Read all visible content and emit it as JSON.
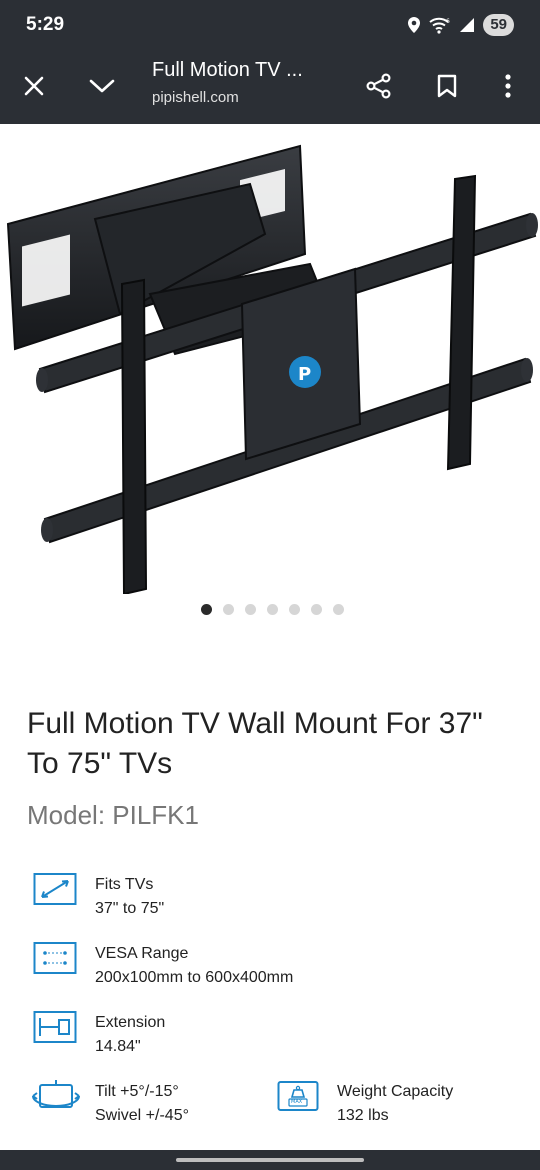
{
  "status_bar": {
    "time": "5:29",
    "battery": "59",
    "icons": [
      "location-icon",
      "wifi-6-icon",
      "signal-icon"
    ]
  },
  "toolbar": {
    "page_title": "Full Motion TV ...",
    "url": "pipishell.com",
    "buttons": [
      "close-icon",
      "chevron-down-icon",
      "share-icon",
      "bookmark-icon",
      "more-vert-icon"
    ]
  },
  "gallery": {
    "total_images": 7,
    "active_index": 0
  },
  "product": {
    "title": "Full Motion TV Wall Mount For 37\" To 75\" TVs",
    "model": "Model: PILFK1"
  },
  "specs": {
    "fits": {
      "label": "Fits TVs",
      "value": "37\" to 75\""
    },
    "vesa": {
      "label": "VESA Range",
      "value": "200x100mm to 600x400mm"
    },
    "extension": {
      "label": "Extension",
      "value": "14.84\""
    },
    "tilt": {
      "label": "Tilt +5°/-15°",
      "value": "Swivel +/-45°"
    },
    "weight": {
      "label": "Weight Capacity",
      "value": "132 lbs",
      "icon_text": "MAX"
    }
  },
  "colors": {
    "accent_blue": "#1c86c9",
    "bar": "#2b2f35"
  }
}
